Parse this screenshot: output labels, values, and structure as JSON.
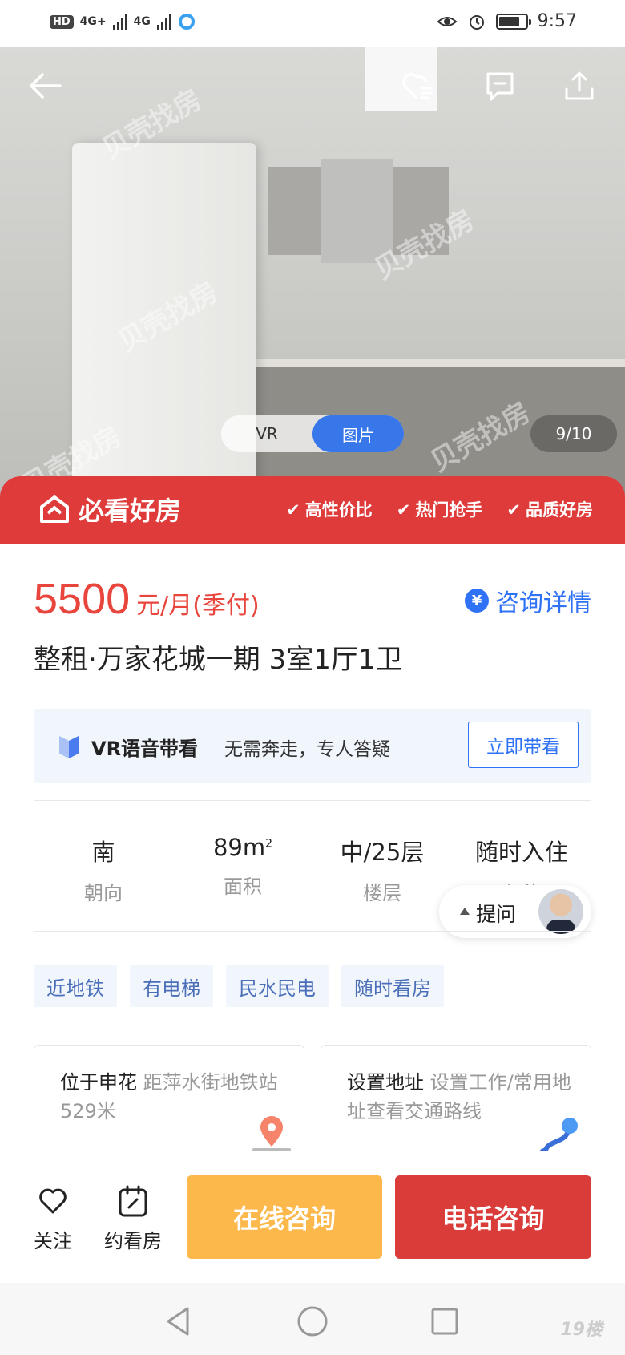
{
  "status_bar": {
    "hd": "HD",
    "sim1_net": "4G+",
    "sim2_net": "4G",
    "time": "9:57"
  },
  "hero": {
    "toggle": [
      "VR",
      "图片"
    ],
    "active_toggle": "图片",
    "counter": "9/10",
    "watermark": "贝壳找房"
  },
  "banner": {
    "logo_text": "必看好房",
    "tags": [
      "高性价比",
      "热门抢手",
      "品质好房"
    ]
  },
  "listing": {
    "price": "5500",
    "price_unit": "元/月(季付)",
    "consult_label": "咨询详情",
    "consult_icon": "¥",
    "title": "整租·万家花城一期 3室1厅1卫"
  },
  "vr_panel": {
    "title": "VR语音带看",
    "desc": "无需奔走，专人答疑",
    "button": "立即带看"
  },
  "specs": [
    {
      "value": "南",
      "label": "朝向"
    },
    {
      "value": "89m",
      "sup": "2",
      "label": "面积"
    },
    {
      "value": "中/25层",
      "label": "楼层"
    },
    {
      "value": "随时入住",
      "label": "入住"
    }
  ],
  "ask": {
    "label": "提问"
  },
  "tags": [
    "近地铁",
    "有电梯",
    "民水民电",
    "随时看房"
  ],
  "location_cards": [
    {
      "head": "位于申花",
      "body": "距萍水街地铁站529米"
    },
    {
      "head": "设置地址",
      "body": "设置工作/常用地址查看交通路线"
    }
  ],
  "bottom_bar": {
    "follow": "关注",
    "book": "约看房",
    "online": "在线咨询",
    "phone": "电话咨询"
  },
  "brand_watermark": "19楼"
}
